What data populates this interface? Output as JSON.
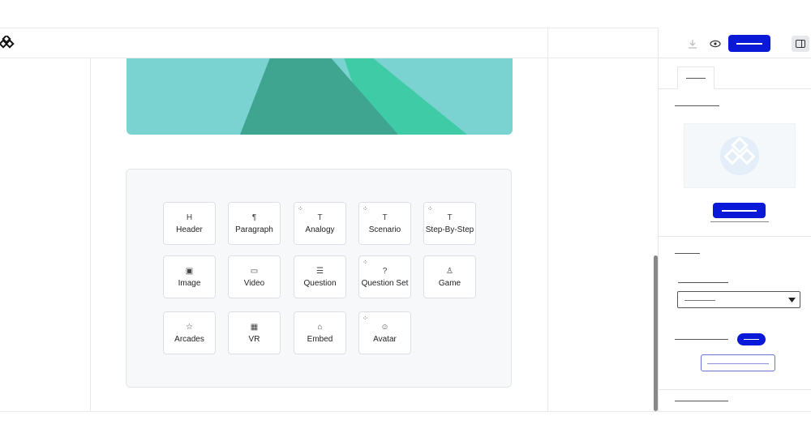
{
  "icons": {
    "logo": "logo-icon",
    "download": "download-icon",
    "preview": "eye-icon",
    "panel_toggle": "sidebar-toggle-icon",
    "dropdown": "caret-down-icon"
  },
  "colors": {
    "accent": "#0a18d8",
    "hero_bg": "#7ad3d0",
    "mountain_dark": "#3fa591",
    "mountain_light": "#3ecba6"
  },
  "blocks": [
    {
      "label": "Header",
      "icon": "H",
      "ai": false
    },
    {
      "label": "Paragraph",
      "icon": "¶",
      "ai": false
    },
    {
      "label": "Analogy",
      "icon": "T",
      "ai": true
    },
    {
      "label": "Scenario",
      "icon": "T",
      "ai": true
    },
    {
      "label": "Step-By-Step",
      "icon": "T",
      "ai": true
    },
    {
      "label": "Image",
      "icon": "▣",
      "ai": false
    },
    {
      "label": "Video",
      "icon": "▭",
      "ai": false
    },
    {
      "label": "Question",
      "icon": "☰",
      "ai": false
    },
    {
      "label": "Question Set",
      "icon": "?",
      "ai": true
    },
    {
      "label": "Game",
      "icon": "♙",
      "ai": false
    },
    {
      "label": "Arcades",
      "icon": "☆",
      "ai": false
    },
    {
      "label": "VR",
      "icon": "▦",
      "ai": false
    },
    {
      "label": "Embed",
      "icon": "⌂",
      "ai": false
    },
    {
      "label": "Avatar",
      "icon": "☺",
      "ai": true
    }
  ],
  "ai_marker": "⁘"
}
